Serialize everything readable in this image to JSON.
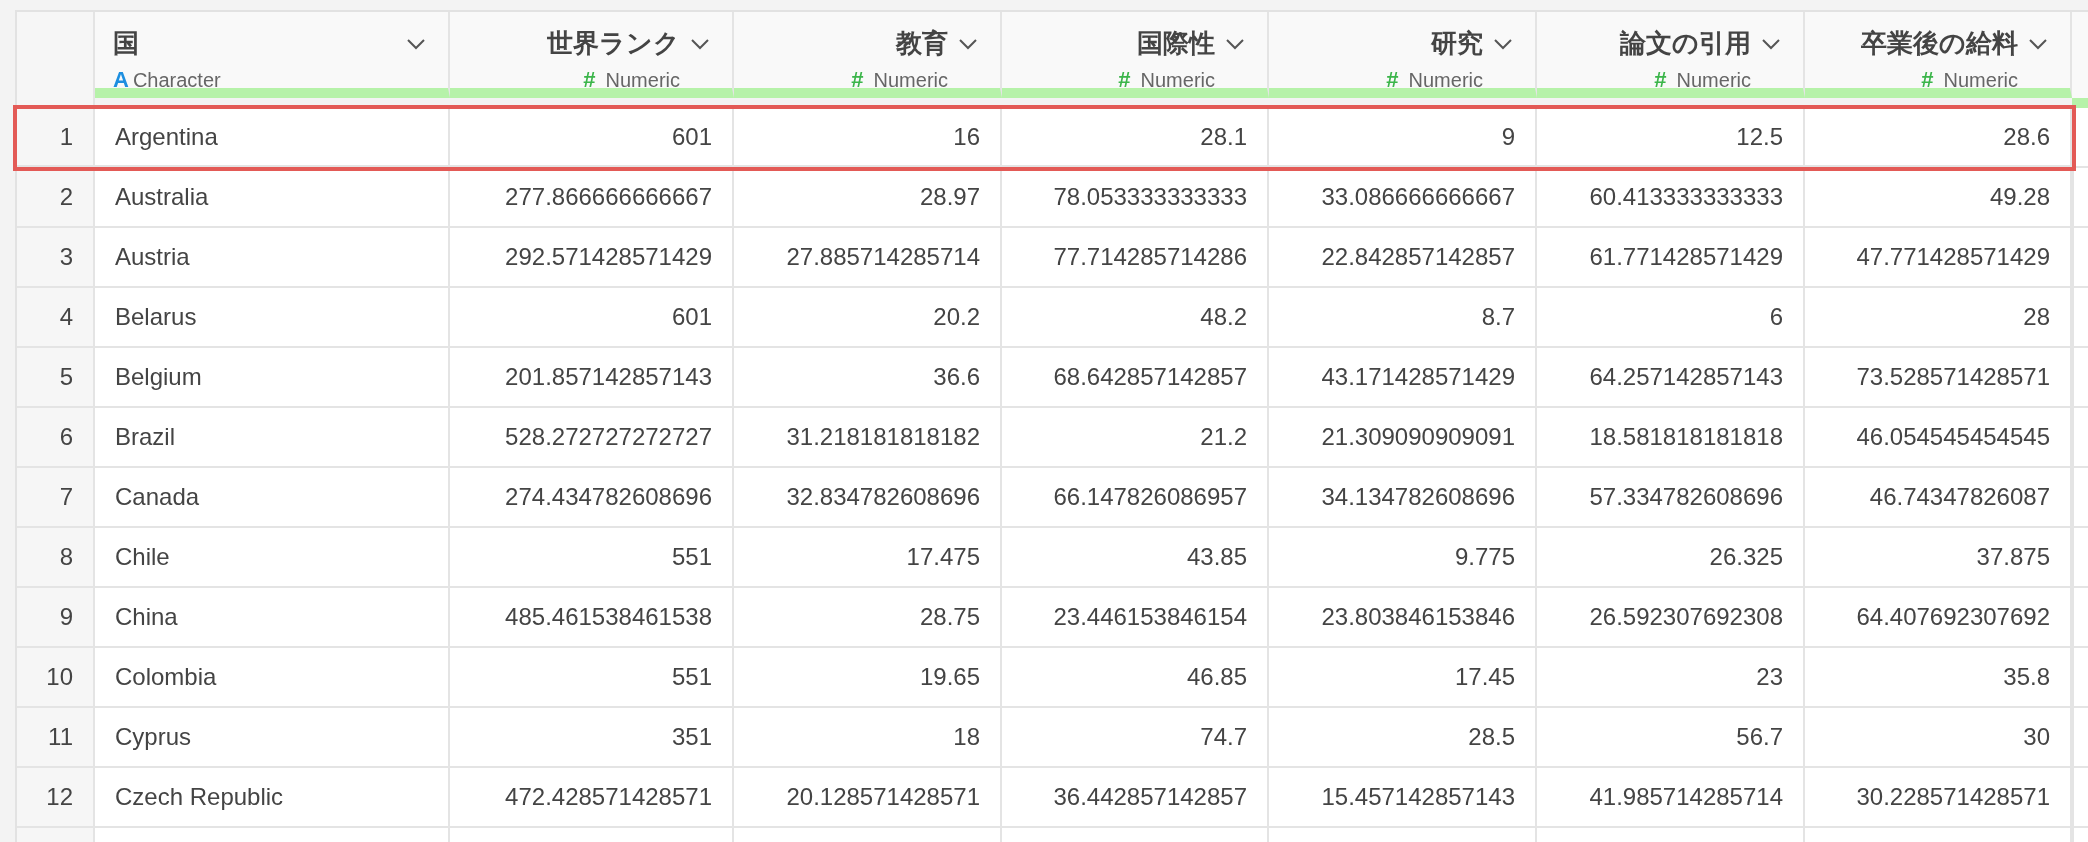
{
  "columns": [
    {
      "title": "国",
      "kind": "character",
      "type_icon": "A",
      "type_label": "Character"
    },
    {
      "title": "世界ランク",
      "kind": "numeric",
      "type_icon": "#",
      "type_label": "Numeric"
    },
    {
      "title": "教育",
      "kind": "numeric",
      "type_icon": "#",
      "type_label": "Numeric"
    },
    {
      "title": "国際性",
      "kind": "numeric",
      "type_icon": "#",
      "type_label": "Numeric"
    },
    {
      "title": "研究",
      "kind": "numeric",
      "type_icon": "#",
      "type_label": "Numeric"
    },
    {
      "title": "論文の引用",
      "kind": "numeric",
      "type_icon": "#",
      "type_label": "Numeric"
    },
    {
      "title": "卒業後の給料",
      "kind": "numeric",
      "type_icon": "#",
      "type_label": "Numeric"
    }
  ],
  "rows": [
    {
      "number": "1",
      "selected": true,
      "cells": [
        "Argentina",
        "601",
        "16",
        "28.1",
        "9",
        "12.5",
        "28.6"
      ]
    },
    {
      "number": "2",
      "selected": false,
      "cells": [
        "Australia",
        "277.866666666667",
        "28.97",
        "78.053333333333",
        "33.086666666667",
        "60.413333333333",
        "49.28"
      ]
    },
    {
      "number": "3",
      "selected": false,
      "cells": [
        "Austria",
        "292.571428571429",
        "27.885714285714",
        "77.714285714286",
        "22.842857142857",
        "61.771428571429",
        "47.771428571429"
      ]
    },
    {
      "number": "4",
      "selected": false,
      "cells": [
        "Belarus",
        "601",
        "20.2",
        "48.2",
        "8.7",
        "6",
        "28"
      ]
    },
    {
      "number": "5",
      "selected": false,
      "cells": [
        "Belgium",
        "201.857142857143",
        "36.6",
        "68.642857142857",
        "43.171428571429",
        "64.257142857143",
        "73.528571428571"
      ]
    },
    {
      "number": "6",
      "selected": false,
      "cells": [
        "Brazil",
        "528.272727272727",
        "31.218181818182",
        "21.2",
        "21.309090909091",
        "18.581818181818",
        "46.054545454545"
      ]
    },
    {
      "number": "7",
      "selected": false,
      "cells": [
        "Canada",
        "274.434782608696",
        "32.834782608696",
        "66.147826086957",
        "34.134782608696",
        "57.334782608696",
        "46.74347826087"
      ]
    },
    {
      "number": "8",
      "selected": false,
      "cells": [
        "Chile",
        "551",
        "17.475",
        "43.85",
        "9.775",
        "26.325",
        "37.875"
      ]
    },
    {
      "number": "9",
      "selected": false,
      "cells": [
        "China",
        "485.461538461538",
        "28.75",
        "23.446153846154",
        "23.803846153846",
        "26.592307692308",
        "64.407692307692"
      ]
    },
    {
      "number": "10",
      "selected": false,
      "cells": [
        "Colombia",
        "551",
        "19.65",
        "46.85",
        "17.45",
        "23",
        "35.8"
      ]
    },
    {
      "number": "11",
      "selected": false,
      "cells": [
        "Cyprus",
        "351",
        "18",
        "74.7",
        "28.5",
        "56.7",
        "30"
      ]
    },
    {
      "number": "12",
      "selected": false,
      "cells": [
        "Czech Republic",
        "472.428571428571",
        "20.128571428571",
        "36.442857142857",
        "15.457142857143",
        "41.985714285714",
        "30.228571428571"
      ]
    }
  ]
}
